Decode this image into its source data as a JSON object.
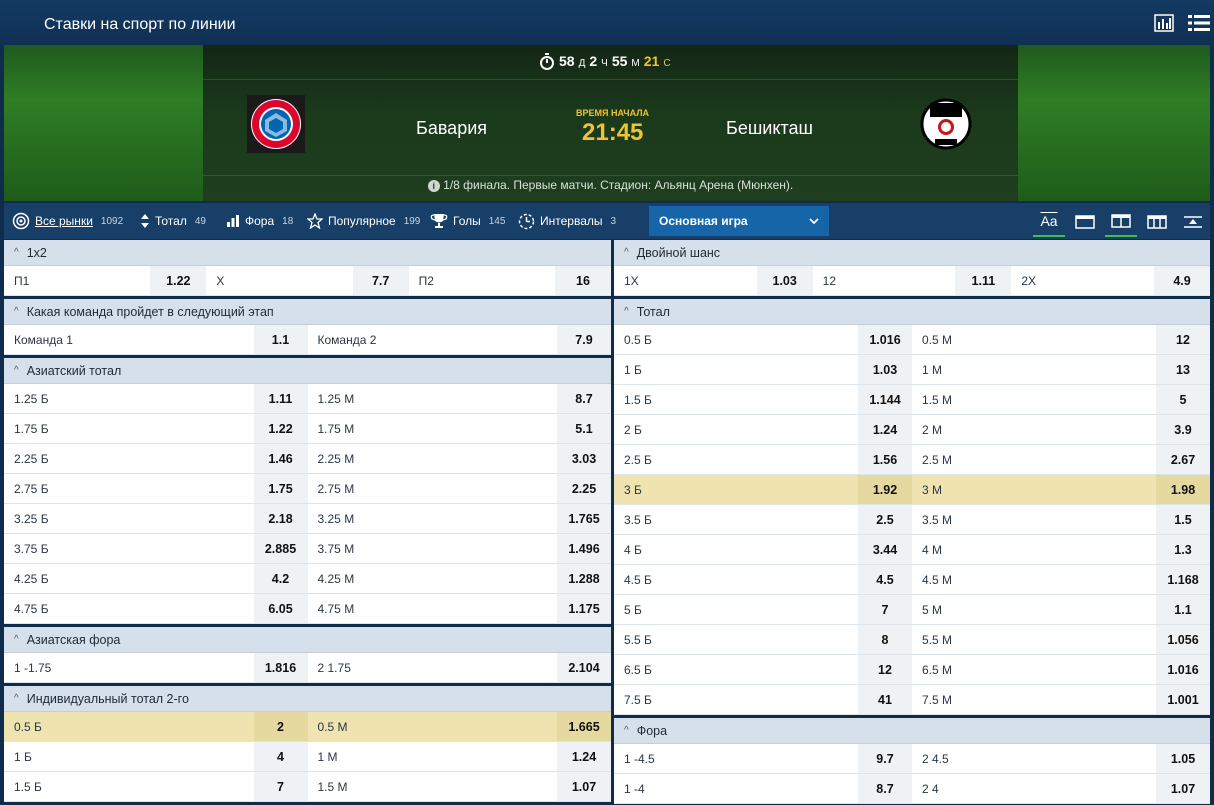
{
  "header": {
    "title": "Ставки на спорт по линии"
  },
  "match": {
    "timer": {
      "d": "58",
      "d_unit": "Д",
      "h": "2",
      "h_unit": "Ч",
      "m": "55",
      "m_unit": "М",
      "s": "21",
      "s_unit": "С"
    },
    "team1": "Бавария",
    "team2": "Бешикташ",
    "start_label": "ВРЕМЯ НАЧАЛА",
    "start_time": "21:45",
    "info": "1/8 финала. Первые матчи. Стадион: Альянц Арена (Мюнхен)."
  },
  "filters": [
    {
      "label": "Все рынки",
      "count": "1092"
    },
    {
      "label": "Тотал",
      "count": "49"
    },
    {
      "label": "Фора",
      "count": "18"
    },
    {
      "label": "Популярное",
      "count": "199"
    },
    {
      "label": "Голы",
      "count": "145"
    },
    {
      "label": "Интервалы",
      "count": "3"
    }
  ],
  "select": {
    "value": "Основная игра"
  },
  "view_icons": {
    "font": "Aa"
  },
  "colors": {
    "accent": "#1565a8",
    "highlight": "#efe4b0",
    "gold": "#f0c331"
  },
  "left_markets": [
    {
      "title": "1x2",
      "cols": 3,
      "rows": [
        [
          [
            "П1",
            "1.22"
          ],
          [
            "X",
            "7.7"
          ],
          [
            "П2",
            "16"
          ]
        ]
      ]
    },
    {
      "title": "Какая команда пройдет в следующий этап",
      "cols": 2,
      "rows": [
        [
          [
            "Команда 1",
            "1.1"
          ],
          [
            "Команда 2",
            "7.9"
          ]
        ]
      ]
    },
    {
      "title": "Азиатский тотал",
      "cols": 2,
      "rows": [
        [
          [
            "1.25 Б",
            "1.11"
          ],
          [
            "1.25 М",
            "8.7"
          ]
        ],
        [
          [
            "1.75 Б",
            "1.22"
          ],
          [
            "1.75 М",
            "5.1"
          ]
        ],
        [
          [
            "2.25 Б",
            "1.46"
          ],
          [
            "2.25 М",
            "3.03"
          ]
        ],
        [
          [
            "2.75 Б",
            "1.75"
          ],
          [
            "2.75 М",
            "2.25"
          ]
        ],
        [
          [
            "3.25 Б",
            "2.18"
          ],
          [
            "3.25 М",
            "1.765"
          ]
        ],
        [
          [
            "3.75 Б",
            "2.885"
          ],
          [
            "3.75 М",
            "1.496"
          ]
        ],
        [
          [
            "4.25 Б",
            "4.2"
          ],
          [
            "4.25 М",
            "1.288"
          ]
        ],
        [
          [
            "4.75 Б",
            "6.05"
          ],
          [
            "4.75 М",
            "1.175"
          ]
        ]
      ]
    },
    {
      "title": "Азиатская фора",
      "cols": 2,
      "rows": [
        [
          [
            "1 -1.75",
            "1.816"
          ],
          [
            "2 1.75",
            "2.104"
          ]
        ]
      ]
    },
    {
      "title": "Индивидуальный тотал 2-го",
      "cols": 2,
      "highlight": 0,
      "rows": [
        [
          [
            "0.5 Б",
            "2"
          ],
          [
            "0.5 М",
            "1.665"
          ]
        ],
        [
          [
            "1 Б",
            "4"
          ],
          [
            "1 М",
            "1.24"
          ]
        ],
        [
          [
            "1.5 Б",
            "7"
          ],
          [
            "1.5 М",
            "1.07"
          ]
        ]
      ]
    }
  ],
  "right_markets": [
    {
      "title": "Двойной шанс",
      "cols": 3,
      "rows": [
        [
          [
            "1X",
            "1.03"
          ],
          [
            "12",
            "1.11"
          ],
          [
            "2X",
            "4.9"
          ]
        ]
      ]
    },
    {
      "title": "Тотал",
      "cols": 2,
      "highlight": 5,
      "rows": [
        [
          [
            "0.5 Б",
            "1.016"
          ],
          [
            "0.5 М",
            "12"
          ]
        ],
        [
          [
            "1 Б",
            "1.03"
          ],
          [
            "1 М",
            "13"
          ]
        ],
        [
          [
            "1.5 Б",
            "1.144"
          ],
          [
            "1.5 М",
            "5"
          ]
        ],
        [
          [
            "2 Б",
            "1.24"
          ],
          [
            "2 М",
            "3.9"
          ]
        ],
        [
          [
            "2.5 Б",
            "1.56"
          ],
          [
            "2.5 М",
            "2.67"
          ]
        ],
        [
          [
            "3 Б",
            "1.92"
          ],
          [
            "3 М",
            "1.98"
          ]
        ],
        [
          [
            "3.5 Б",
            "2.5"
          ],
          [
            "3.5 М",
            "1.5"
          ]
        ],
        [
          [
            "4 Б",
            "3.44"
          ],
          [
            "4 М",
            "1.3"
          ]
        ],
        [
          [
            "4.5 Б",
            "4.5"
          ],
          [
            "4.5 М",
            "1.168"
          ]
        ],
        [
          [
            "5 Б",
            "7"
          ],
          [
            "5 М",
            "1.1"
          ]
        ],
        [
          [
            "5.5 Б",
            "8"
          ],
          [
            "5.5 М",
            "1.056"
          ]
        ],
        [
          [
            "6.5 Б",
            "12"
          ],
          [
            "6.5 М",
            "1.016"
          ]
        ],
        [
          [
            "7.5 Б",
            "41"
          ],
          [
            "7.5 М",
            "1.001"
          ]
        ]
      ]
    },
    {
      "title": "Фора",
      "cols": 2,
      "rows": [
        [
          [
            "1 -4.5",
            "9.7"
          ],
          [
            "2 4.5",
            "1.05"
          ]
        ],
        [
          [
            "1 -4",
            "8.7"
          ],
          [
            "2 4",
            "1.07"
          ]
        ]
      ]
    }
  ]
}
